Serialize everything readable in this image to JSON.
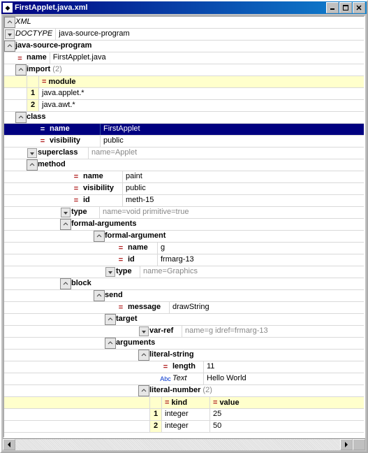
{
  "window": {
    "title": "FirstApplet.java.xml"
  },
  "top": {
    "xml_label": "XML",
    "doctype_label": "DOCTYPE",
    "doctype_value": "java-source-program"
  },
  "tree": {
    "root": "java-source-program",
    "name_label": "name",
    "name_value": "FirstApplet.java",
    "import_label": "import",
    "import_count": "(2)",
    "import_col": "module",
    "imports": [
      "java.applet.*",
      "java.awt.*"
    ],
    "class_label": "class",
    "class": {
      "name_label": "name",
      "name_value": "FirstApplet",
      "vis_label": "visibility",
      "vis_value": "public",
      "super_label": "superclass",
      "super_value": "name=Applet",
      "method_label": "method",
      "method": {
        "name_label": "name",
        "name_value": "paint",
        "vis_label": "visibility",
        "vis_value": "public",
        "id_label": "id",
        "id_value": "meth-15",
        "type_label": "type",
        "type_value": "name=void primitive=true",
        "formals_label": "formal-arguments",
        "formal": {
          "label": "formal-argument",
          "name_label": "name",
          "name_value": "g",
          "id_label": "id",
          "id_value": "frmarg-13",
          "type_label": "type",
          "type_value": "name=Graphics"
        },
        "block_label": "block",
        "send_label": "send",
        "send": {
          "message_label": "message",
          "message_value": "drawString",
          "target_label": "target",
          "varref_label": "var-ref",
          "varref_value": "name=g idref=frmarg-13",
          "args_label": "arguments",
          "litstr_label": "literal-string",
          "litstr_length_label": "length",
          "litstr_length_value": "11",
          "litstr_text_label": "Text",
          "litstr_text_value": "Hello World",
          "litnum_label": "literal-number",
          "litnum_count": "(2)",
          "litnum_col_kind": "kind",
          "litnum_col_value": "value",
          "litnums": [
            {
              "kind": "integer",
              "value": "25"
            },
            {
              "kind": "integer",
              "value": "50"
            }
          ]
        }
      }
    }
  }
}
